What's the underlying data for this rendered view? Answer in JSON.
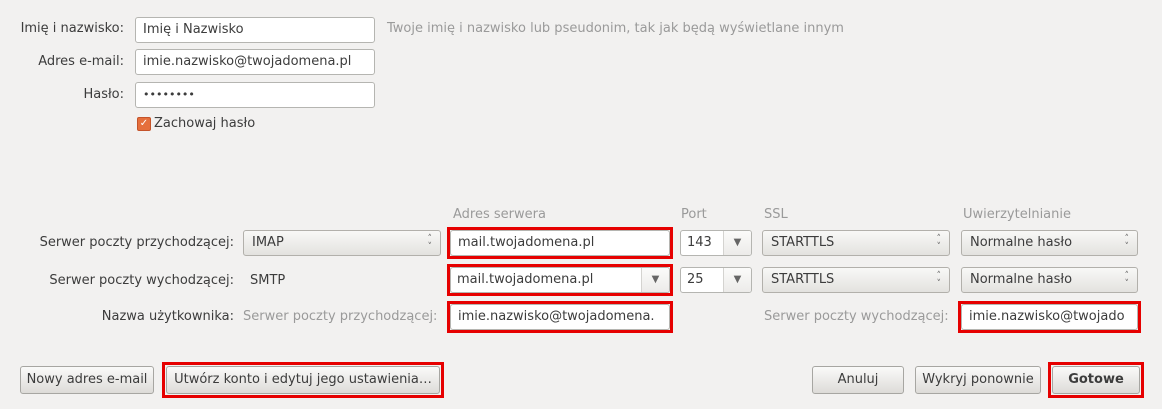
{
  "identity": {
    "name_label": "Imię i nazwisko:",
    "name_value": "Imię i Nazwisko",
    "name_hint": "Twoje imię i nazwisko lub pseudonim, tak jak będą wyświetlane innym",
    "email_label": "Adres e-mail:",
    "email_value": "imie.nazwisko@twojadomena.pl",
    "password_label": "Hasło:",
    "password_value": "••••••••",
    "remember_label": "Zachowaj hasło",
    "remember_checked": true
  },
  "server_table": {
    "headers": {
      "address": "Adres serwera",
      "port": "Port",
      "ssl": "SSL",
      "auth": "Uwierzytelnianie"
    },
    "incoming": {
      "label": "Serwer poczty przychodzącej:",
      "protocol": "IMAP",
      "server": "mail.twojadomena.pl",
      "port": "143",
      "ssl": "STARTTLS",
      "auth": "Normalne hasło"
    },
    "outgoing": {
      "label": "Serwer poczty wychodzącej:",
      "protocol": "SMTP",
      "server": "mail.twojadomena.pl",
      "port": "25",
      "ssl": "STARTTLS",
      "auth": "Normalne hasło"
    },
    "username": {
      "label": "Nazwa użytkownika:",
      "incoming_hint": "Serwer poczty przychodzącej:",
      "incoming_value": "imie.nazwisko@twojadomena.",
      "outgoing_hint": "Serwer poczty wychodzącej:",
      "outgoing_value": "imie.nazwisko@twojado"
    }
  },
  "buttons": {
    "new_email": "Nowy adres e-mail",
    "create_account": "Utwórz konto i edytuj jego ustawienia…",
    "cancel": "Anuluj",
    "redetect": "Wykryj ponownie",
    "done": "Gotowe"
  },
  "highlight_color": "#e60000"
}
